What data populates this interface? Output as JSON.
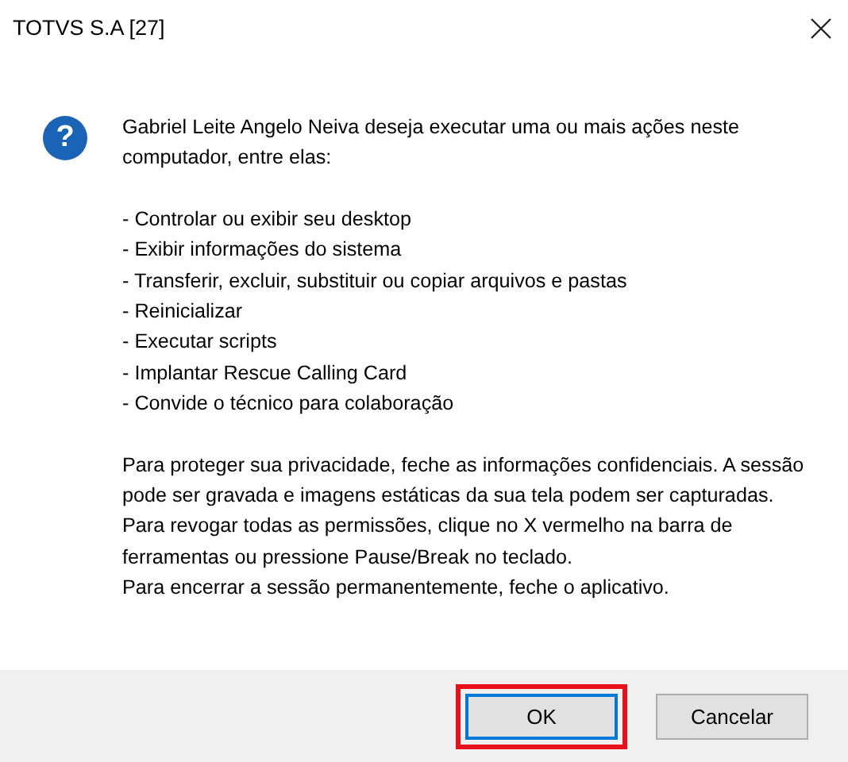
{
  "window": {
    "title": "TOTVS S.A [27]"
  },
  "message": {
    "icon": "?",
    "intro": "Gabriel Leite Angelo Neiva deseja executar uma ou mais ações neste computador, entre elas:",
    "actions": [
      "- Controlar ou exibir seu desktop",
      "- Exibir informações do sistema",
      "- Transferir, excluir, substituir ou copiar arquivos e pastas",
      "- Reinicializar",
      "- Executar scripts",
      "- Implantar Rescue Calling Card",
      "- Convide o técnico para colaboração"
    ],
    "notes": [
      "Para proteger sua privacidade, feche as informações confidenciais. A sessão pode ser gravada e imagens estáticas da sua tela podem ser capturadas.",
      "Para revogar todas as permissões, clique no X vermelho na barra de ferramentas ou pressione Pause/Break no teclado.",
      "Para encerrar a sessão permanentemente, feche o aplicativo."
    ]
  },
  "buttons": [
    {
      "label": "OK",
      "highlighted": true
    },
    {
      "label": "Cancelar",
      "highlighted": false
    }
  ]
}
